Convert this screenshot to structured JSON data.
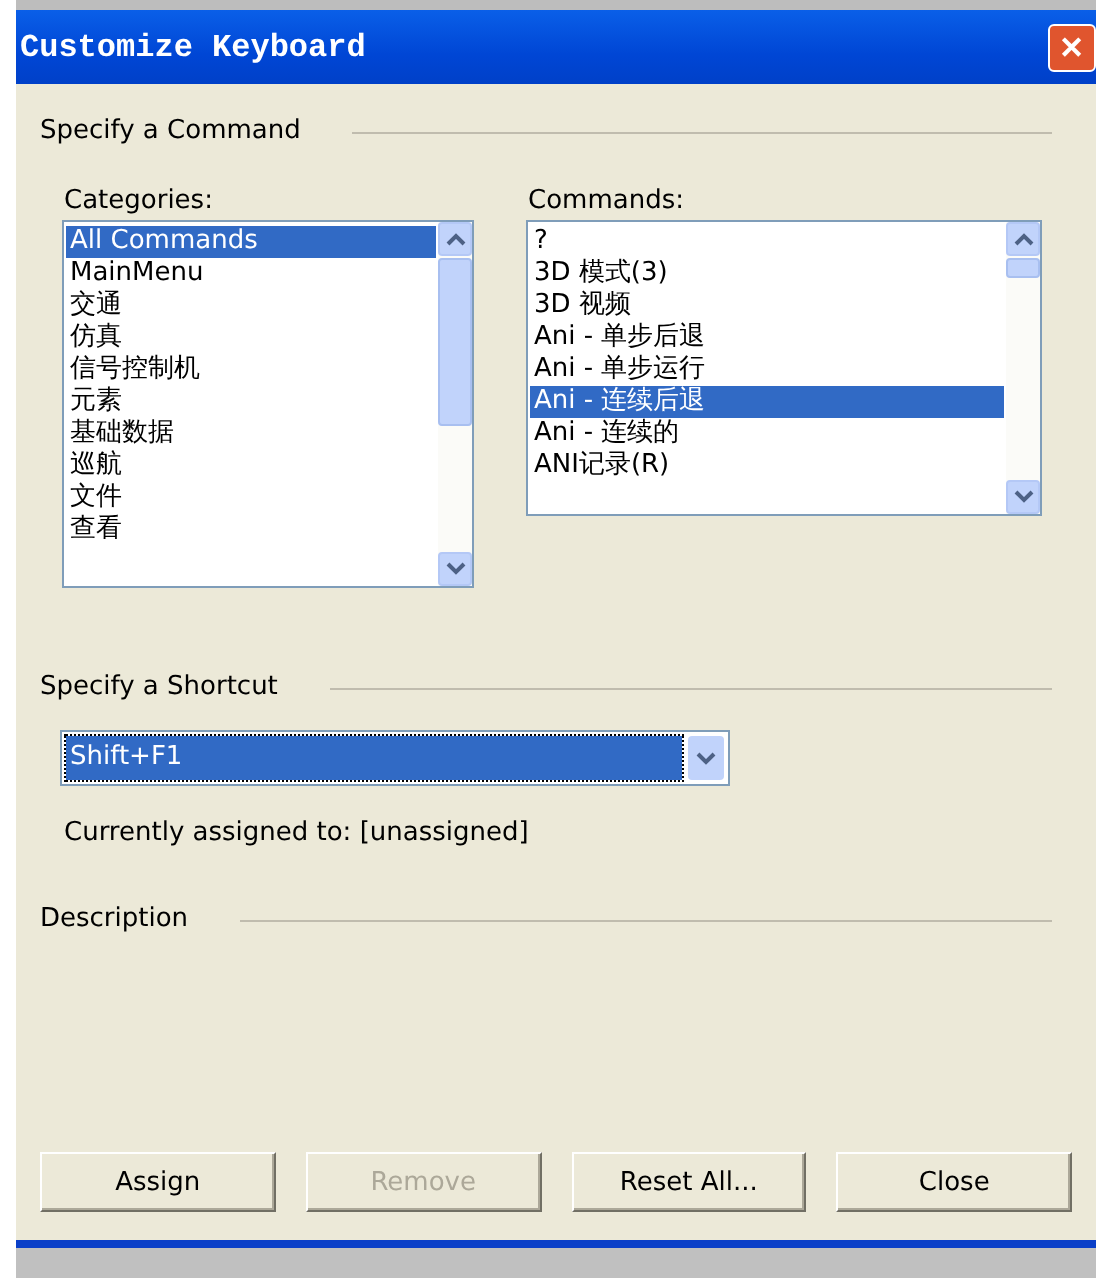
{
  "window": {
    "title": "Customize Keyboard",
    "close": "✕"
  },
  "command_section": {
    "title": "Specify a Command",
    "categories": {
      "label": "Categories:",
      "items": [
        {
          "label": "All Commands",
          "selected": true
        },
        {
          "label": "MainMenu",
          "selected": false
        },
        {
          "label": "交通",
          "selected": false
        },
        {
          "label": "仿真",
          "selected": false
        },
        {
          "label": "信号控制机",
          "selected": false
        },
        {
          "label": "元素",
          "selected": false
        },
        {
          "label": "基础数据",
          "selected": false
        },
        {
          "label": "巡航",
          "selected": false
        },
        {
          "label": "文件",
          "selected": false
        },
        {
          "label": "查看",
          "selected": false
        }
      ]
    },
    "commands": {
      "label": "Commands:",
      "items": [
        {
          "label": "?",
          "selected": false
        },
        {
          "label": "3D 模式(3)",
          "selected": false
        },
        {
          "label": "3D 视频",
          "selected": false
        },
        {
          "label": "Ani - 单步后退",
          "selected": false
        },
        {
          "label": "Ani - 单步运行",
          "selected": false
        },
        {
          "label": "Ani - 连续后退",
          "selected": true
        },
        {
          "label": "Ani - 连续的",
          "selected": false
        },
        {
          "label": "ANI记录(R)",
          "selected": false
        }
      ]
    }
  },
  "shortcut_section": {
    "title": "Specify a Shortcut",
    "value": "Shift+F1",
    "assigned": "Currently assigned to: [unassigned]"
  },
  "description_section": {
    "title": "Description"
  },
  "buttons": [
    {
      "label": "Assign",
      "disabled": false
    },
    {
      "label": "Remove",
      "disabled": true
    },
    {
      "label": "Reset All...",
      "disabled": false
    },
    {
      "label": "Close",
      "disabled": false
    }
  ]
}
